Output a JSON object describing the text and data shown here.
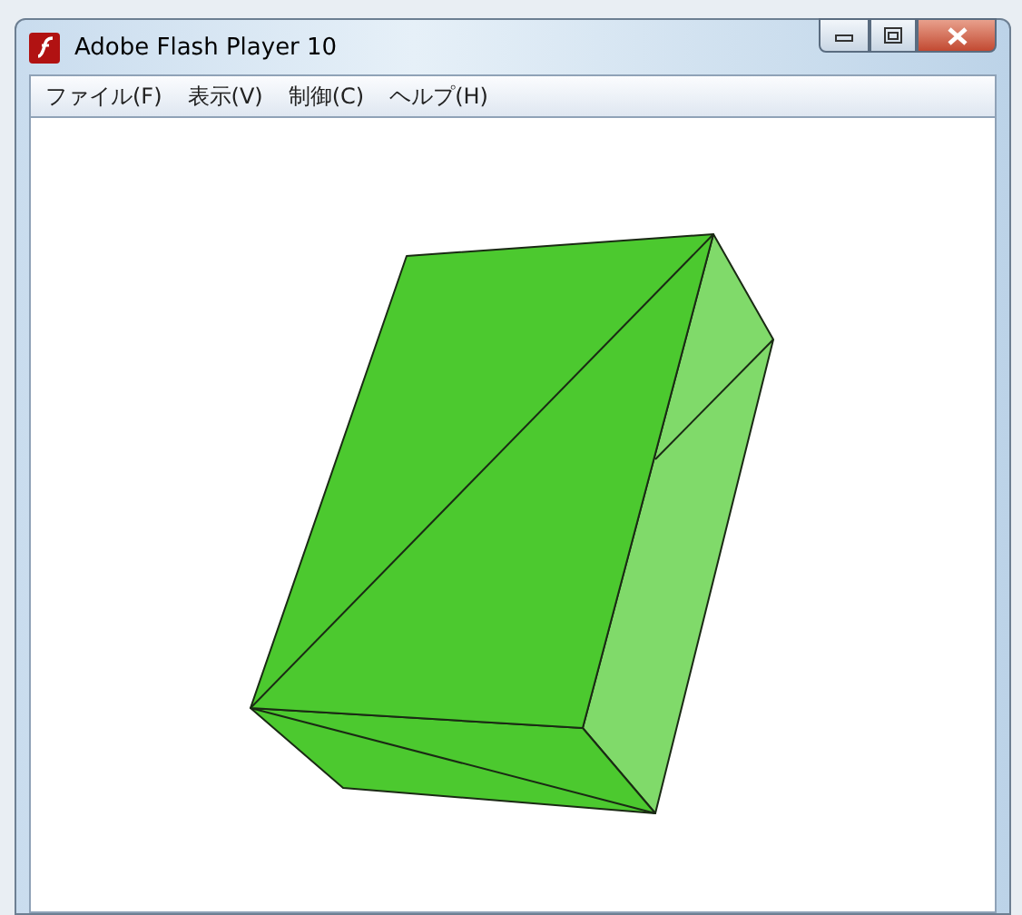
{
  "window": {
    "title": "Adobe Flash Player 10"
  },
  "menu": [
    {
      "label": "ファイル(F)"
    },
    {
      "label": "表示(V)"
    },
    {
      "label": "制御(C)"
    },
    {
      "label": "ヘルプ(H)"
    }
  ]
}
